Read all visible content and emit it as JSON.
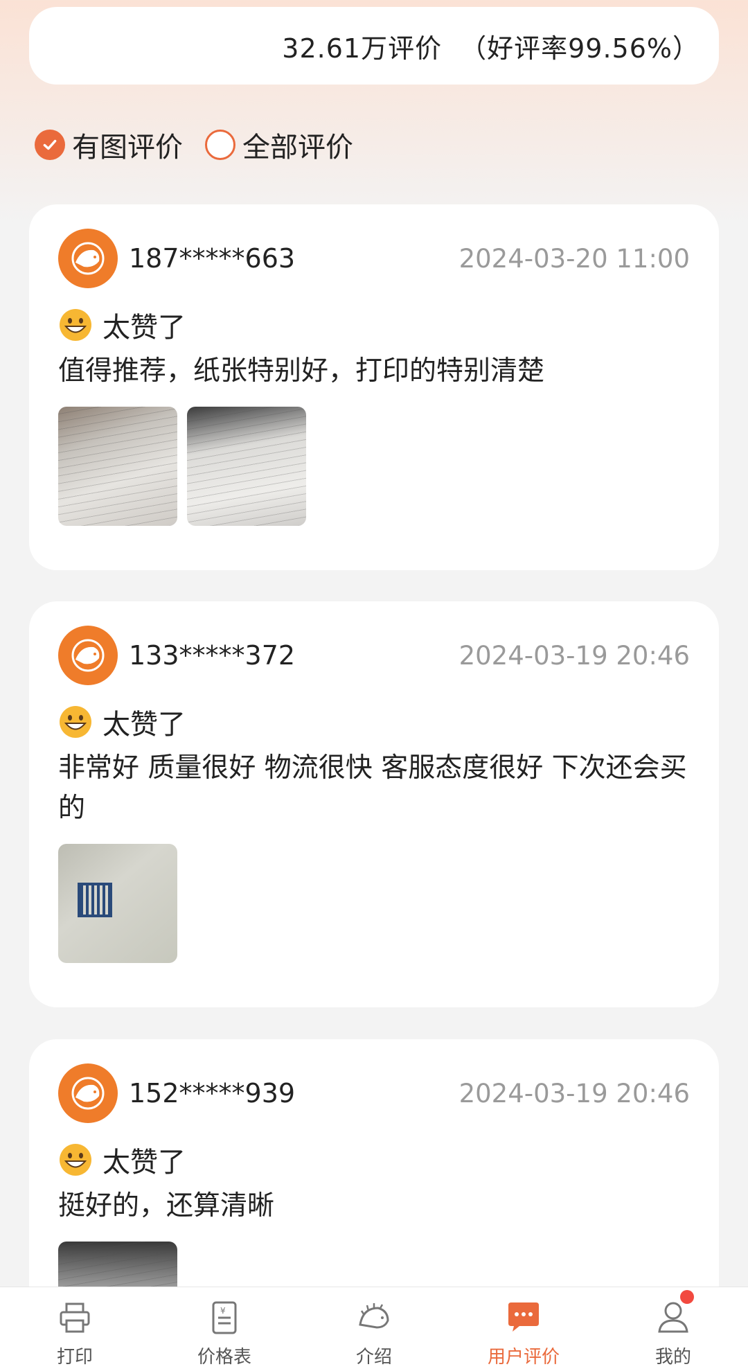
{
  "summary": {
    "count": "32.61万评价",
    "rate": "（好评率99.56%）"
  },
  "filters": [
    {
      "label": "有图评价",
      "checked": true
    },
    {
      "label": "全部评价",
      "checked": false
    }
  ],
  "reviews": [
    {
      "user": "187*****663",
      "time": "2024-03-20 11:00",
      "rating": "太赞了",
      "comment": "值得推荐，纸张特别好，打印的特别清楚"
    },
    {
      "user": "133*****372",
      "time": "2024-03-19 20:46",
      "rating": "太赞了",
      "comment": "非常好 质量很好 物流很快 客服态度很好 下次还会买的"
    },
    {
      "user": "152*****939",
      "time": "2024-03-19 20:46",
      "rating": "太赞了",
      "comment": "挺好的，还算清晰"
    }
  ],
  "tabbar": {
    "items": [
      {
        "label": "打印",
        "icon": "printer-icon"
      },
      {
        "label": "价格表",
        "icon": "price-list-icon"
      },
      {
        "label": "介绍",
        "icon": "hedgehog-icon"
      },
      {
        "label": "用户评价",
        "icon": "chat-bubble-icon",
        "active": true
      },
      {
        "label": "我的",
        "icon": "profile-icon",
        "badge": true
      }
    ]
  },
  "colors": {
    "accent": "#ea6a3c",
    "avatar": "#ef7c2a",
    "badge": "#f2493f"
  }
}
